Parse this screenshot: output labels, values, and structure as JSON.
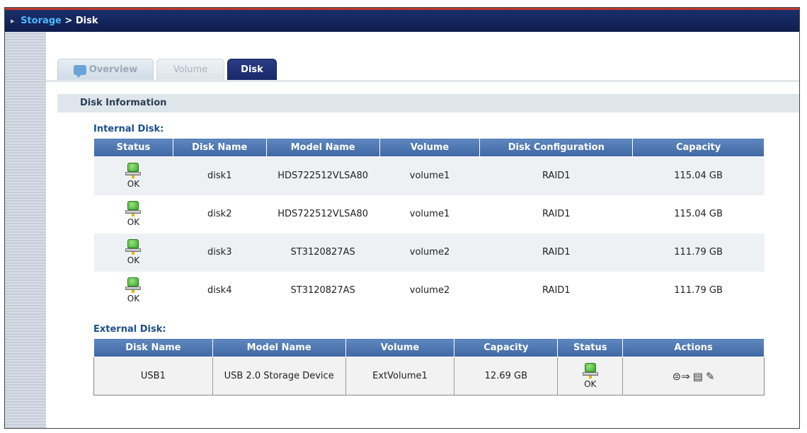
{
  "breadcrumb": {
    "parent": "Storage",
    "separator": ">",
    "current": "Disk"
  },
  "tabs": [
    {
      "label": "Overview",
      "active": false
    },
    {
      "label": "Volume",
      "active": false
    },
    {
      "label": "Disk",
      "active": true
    }
  ],
  "section_title": "Disk Information",
  "internal": {
    "title": "Internal Disk:",
    "headers": [
      "Status",
      "Disk Name",
      "Model Name",
      "Volume",
      "Disk Configuration",
      "Capacity"
    ],
    "rows": [
      {
        "status": "OK",
        "disk_name": "disk1",
        "model": "HDS722512VLSA80",
        "volume": "volume1",
        "config": "RAID1",
        "capacity": "115.04 GB"
      },
      {
        "status": "OK",
        "disk_name": "disk2",
        "model": "HDS722512VLSA80",
        "volume": "volume1",
        "config": "RAID1",
        "capacity": "115.04 GB"
      },
      {
        "status": "OK",
        "disk_name": "disk3",
        "model": "ST3120827AS",
        "volume": "volume2",
        "config": "RAID1",
        "capacity": "111.79 GB"
      },
      {
        "status": "OK",
        "disk_name": "disk4",
        "model": "ST3120827AS",
        "volume": "volume2",
        "config": "RAID1",
        "capacity": "111.79 GB"
      }
    ]
  },
  "external": {
    "title": "External Disk:",
    "headers": [
      "Disk Name",
      "Model Name",
      "Volume",
      "Capacity",
      "Status",
      "Actions"
    ],
    "rows": [
      {
        "disk_name": "USB1",
        "model": "USB 2.0 Storage Device",
        "volume": "ExtVolume1",
        "capacity": "12.69 GB",
        "status": "OK"
      }
    ],
    "action_icons": [
      "eject-icon",
      "edit-list-icon",
      "format-brush-icon"
    ]
  },
  "colors": {
    "header_bar": "#1a2f6a",
    "accent_line": "#c0392b",
    "table_header": "#4a72ad",
    "status_ok": "#37a82b"
  }
}
